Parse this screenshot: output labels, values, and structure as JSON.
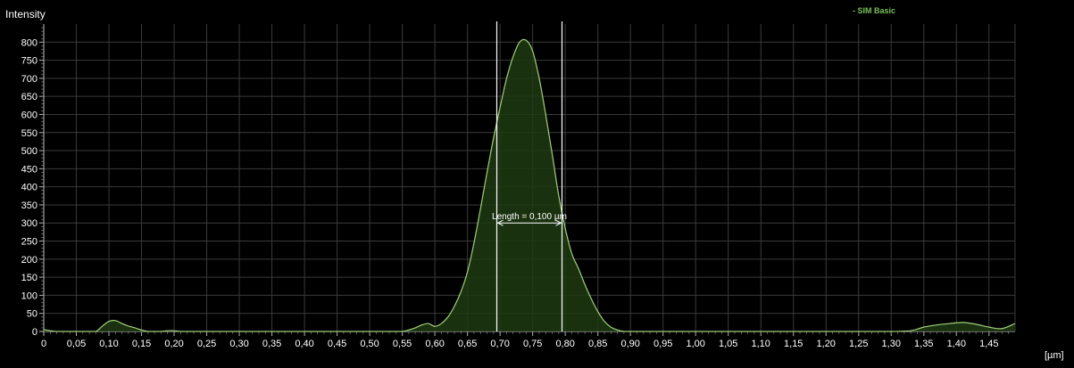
{
  "chart_data": {
    "type": "area",
    "title": "",
    "ylabel": "Intensity",
    "xlabel_unit": "[µm]",
    "legend": "- SIM Basic",
    "legend_color": "#7bbf5a",
    "line_color": "#9fd07a",
    "fill_color": "#1f3a12",
    "background": "#000000",
    "grid": true,
    "xlim": [
      0,
      1.49
    ],
    "ylim": [
      0,
      850
    ],
    "x_ticks": [
      "0",
      "0,05",
      "0,10",
      "0,15",
      "0,20",
      "0,25",
      "0,30",
      "0,35",
      "0,40",
      "0,45",
      "0,50",
      "0,55",
      "0,60",
      "0,65",
      "0,70",
      "0,75",
      "0,80",
      "0,85",
      "0,90",
      "0,95",
      "1,00",
      "1,05",
      "1,10",
      "1,15",
      "1,20",
      "1,25",
      "1,30",
      "1,35",
      "1,40",
      "1,45"
    ],
    "y_ticks": [
      "0",
      "50",
      "100",
      "150",
      "200",
      "250",
      "300",
      "350",
      "400",
      "450",
      "500",
      "550",
      "600",
      "650",
      "700",
      "750",
      "800"
    ],
    "series": [
      {
        "x": [
          0.0,
          0.02,
          0.04,
          0.06,
          0.07,
          0.08,
          0.09,
          0.1,
          0.11,
          0.12,
          0.13,
          0.14,
          0.15,
          0.16,
          0.17,
          0.18,
          0.19,
          0.2,
          0.21,
          0.22,
          0.3,
          0.4,
          0.5,
          0.54,
          0.55,
          0.56,
          0.57,
          0.58,
          0.59,
          0.6,
          0.61,
          0.62,
          0.63,
          0.64,
          0.65,
          0.66,
          0.67,
          0.68,
          0.69,
          0.7,
          0.71,
          0.72,
          0.73,
          0.74,
          0.75,
          0.76,
          0.77,
          0.78,
          0.79,
          0.8,
          0.81,
          0.82,
          0.83,
          0.84,
          0.85,
          0.86,
          0.87,
          0.88,
          0.89,
          0.9,
          1.0,
          1.1,
          1.2,
          1.3,
          1.33,
          1.35,
          1.37,
          1.39,
          1.41,
          1.43,
          1.45,
          1.47,
          1.49
        ],
        "y": [
          5,
          0,
          0,
          0,
          0,
          0,
          15,
          28,
          30,
          22,
          15,
          10,
          4,
          0,
          0,
          0,
          2,
          2,
          0,
          0,
          0,
          0,
          0,
          0,
          0,
          4,
          10,
          18,
          22,
          14,
          22,
          40,
          70,
          110,
          165,
          245,
          340,
          440,
          535,
          620,
          700,
          760,
          800,
          805,
          775,
          700,
          600,
          490,
          375,
          285,
          215,
          175,
          130,
          90,
          55,
          28,
          12,
          4,
          0,
          0,
          0,
          0,
          0,
          0,
          2,
          12,
          18,
          22,
          25,
          20,
          12,
          8,
          22
        ],
        "type": "area"
      }
    ],
    "annotation": {
      "text": "Length = 0,100 µm",
      "cursor_x": [
        0.695,
        0.795
      ],
      "arrow_y": 300,
      "color": "#ffffff"
    }
  }
}
